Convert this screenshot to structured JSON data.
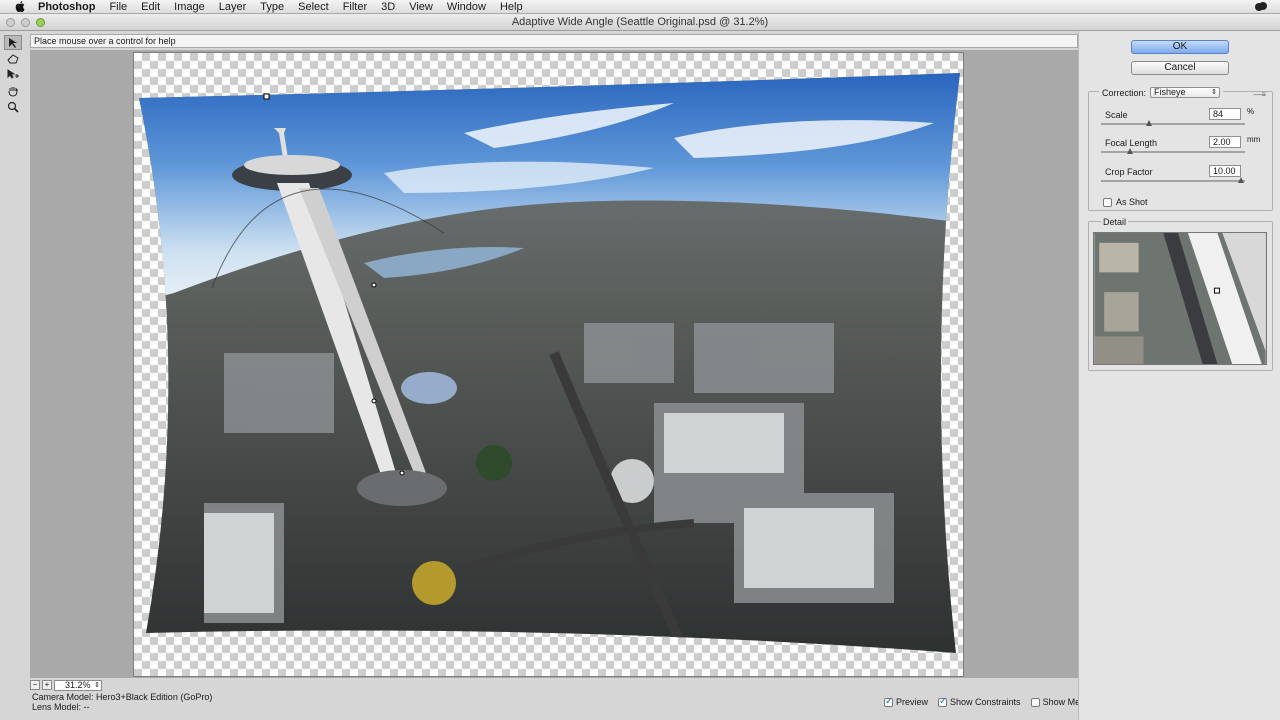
{
  "menubar": {
    "app": "Photoshop",
    "items": [
      "File",
      "Edit",
      "Image",
      "Layer",
      "Type",
      "Select",
      "Filter",
      "3D",
      "View",
      "Window",
      "Help"
    ]
  },
  "window": {
    "title": "Adaptive Wide Angle (Seattle Original.psd @ 31.2%)"
  },
  "tools": [
    "constraint-tool-icon",
    "polygon-constraint-tool-icon",
    "move-tool-icon",
    "hand-tool-icon",
    "zoom-tool-icon"
  ],
  "help_text": "Place mouse over a control for help",
  "zoom": {
    "value": "31.2%"
  },
  "info": {
    "camera": "Camera Model: Hero3+Black Edition (GoPro)",
    "lens": "Lens Model: --"
  },
  "checkboxes": {
    "preview": {
      "label": "Preview",
      "checked": true
    },
    "show_constraints": {
      "label": "Show Constraints",
      "checked": true
    },
    "show_mesh": {
      "label": "Show Mesh",
      "checked": false
    }
  },
  "panel": {
    "ok": "OK",
    "cancel": "Cancel",
    "correction_label": "Correction:",
    "correction_value": "Fisheye",
    "scale": {
      "label": "Scale",
      "value": "84",
      "unit": "%",
      "slider_fraction": 0.33
    },
    "focal_length": {
      "label": "Focal Length",
      "value": "2.00",
      "unit": "mm",
      "slider_fraction": 0.2
    },
    "crop_factor": {
      "label": "Crop Factor",
      "value": "10.00",
      "slider_fraction": 0.97
    },
    "as_shot": {
      "label": "As Shot",
      "checked": false
    },
    "detail_label": "Detail"
  },
  "colors": {
    "ok_button": "#7eaaed",
    "checkbox_check": "#2b6fd6"
  }
}
